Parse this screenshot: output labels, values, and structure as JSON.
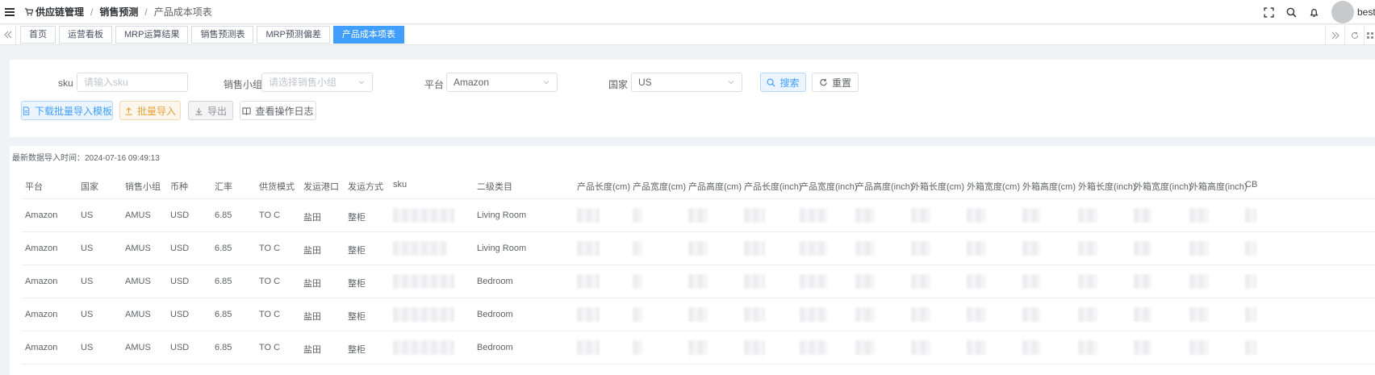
{
  "navbar": {
    "breadcrumb": [
      "供应链管理",
      "销售预测",
      "产品成本项表"
    ],
    "separator": "/",
    "username": "bestie"
  },
  "tags": {
    "items": [
      {
        "label": "首页",
        "active": false
      },
      {
        "label": "运营看板",
        "active": false
      },
      {
        "label": "MRP运算结果",
        "active": false
      },
      {
        "label": "销售预测表",
        "active": false
      },
      {
        "label": "MRP预测偏差",
        "active": false
      },
      {
        "label": "产品成本项表",
        "active": true
      }
    ]
  },
  "filters": {
    "sku": {
      "label": "sku",
      "placeholder": "请输入sku"
    },
    "group": {
      "label": "销售小组",
      "placeholder": "请选择销售小组"
    },
    "platform": {
      "label": "平台",
      "value": "Amazon"
    },
    "country": {
      "label": "国家",
      "value": "US"
    },
    "search_label": "搜索",
    "reset_label": "重置"
  },
  "actions": {
    "download_template": "下载批量导入模板",
    "batch_import": "批量导入",
    "export": "导出",
    "view_log": "查看操作日志"
  },
  "table": {
    "import_time": "最新数据导入时间：2024-07-16 09:49:13",
    "columns": [
      "平台",
      "国家",
      "销售小组",
      "币种",
      "汇率",
      "供货模式",
      "发运港口",
      "发运方式",
      "sku",
      "二级类目",
      "产品长度(cm)",
      "产品宽度(cm)",
      "产品高度(cm)",
      "产品长度(inch)",
      "产品宽度(inch)",
      "产品高度(inch)",
      "外箱长度(cm)",
      "外箱宽度(cm)",
      "外箱高度(cm)",
      "外箱长度(inch)",
      "外箱宽度(inch)",
      "外箱高度(inch)",
      "CB"
    ],
    "rows": [
      {
        "platform": "Amazon",
        "country": "US",
        "group": "AMUS",
        "currency": "USD",
        "rate": "6.85",
        "mode": "TO C",
        "port": "盐田",
        "ship": "整柜",
        "category": "Living Room"
      },
      {
        "platform": "Amazon",
        "country": "US",
        "group": "AMUS",
        "currency": "USD",
        "rate": "6.85",
        "mode": "TO C",
        "port": "盐田",
        "ship": "整柜",
        "category": "Living Room"
      },
      {
        "platform": "Amazon",
        "country": "US",
        "group": "AMUS",
        "currency": "USD",
        "rate": "6.85",
        "mode": "TO C",
        "port": "盐田",
        "ship": "整柜",
        "category": "Bedroom"
      },
      {
        "platform": "Amazon",
        "country": "US",
        "group": "AMUS",
        "currency": "USD",
        "rate": "6.85",
        "mode": "TO C",
        "port": "盐田",
        "ship": "整柜",
        "category": "Bedroom"
      },
      {
        "platform": "Amazon",
        "country": "US",
        "group": "AMUS",
        "currency": "USD",
        "rate": "6.85",
        "mode": "TO C",
        "port": "盐田",
        "ship": "整柜",
        "category": "Bedroom"
      }
    ]
  }
}
